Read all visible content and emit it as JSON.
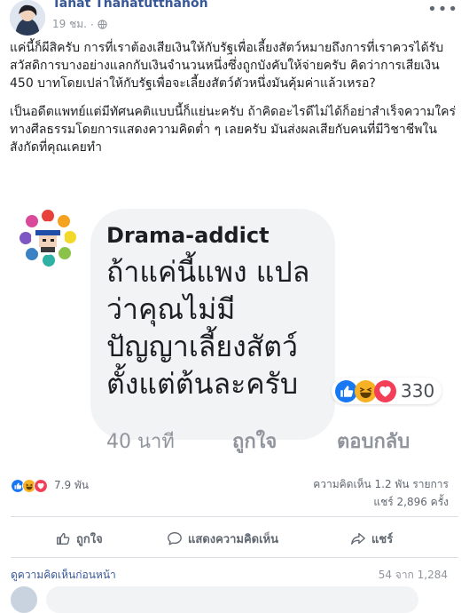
{
  "post": {
    "author": "Tanat Thanatutthanon",
    "time": "19 ชม.",
    "separator": "·",
    "paragraphs": [
      "แค่นี้ก็ผีสิครับ การที่เราต้องเสียเงินให้กับรัฐเพื่อเลี้ยงสัตว์หมายถึงการที่เราควรได้รับสวัสดิการบางอย่างแลกกับเงินจำนวนหนึ่งซึ่งถูกบังคับให้จ่ายครับ คิดว่าการเสียเงิน 450 บาทโดยเปล่าให้กับรัฐเพื่อจะเลี้ยงสัตว์ตัวหนึ่งมันคุ้มค่าแล้วเหรอ?",
      "เป็นอดีตแพทย์แต่มีทัศนคติแบบนี้ก็แย่นะครับ ถ้าคิดอะไรดีไม่ได้ก็อย่าสำเร็จความใคร่ทางศีลธรรมโดยการแสดงความคิดต่ำ ๆ เลยครับ มันส่งผลเสียกับคนที่มีวิชาชีพในสังกัดที่คุณเคยทำ"
    ],
    "more_label": "•••"
  },
  "embedded": {
    "commenter": "Drama-addict",
    "comment_lines": [
      "ถ้าแค่นี้แพง แปล",
      "ว่าคุณไม่มี",
      "ปัญญาเลี้ยงสัตว์",
      "ตั้งแต่ต้นละครับ"
    ],
    "reaction_count": "330",
    "time": "40 นาที",
    "like_label": "ถูกใจ",
    "reply_label": "ตอบกลับ"
  },
  "summary": {
    "reaction_count": "7.9 พัน",
    "comments": "ความคิดเห็น 1.2 พัน รายการ",
    "shares": "แชร์ 2,896 ครั้ง"
  },
  "actions": {
    "like": "ถูกใจ",
    "comment": "แสดงความคิดเห็น",
    "share": "แชร์"
  },
  "comments": {
    "view_previous": "ดูความคิดเห็นก่อนหน้า",
    "pagination": "54 จาก 1,284"
  },
  "colors": {
    "link": "#385898",
    "like_blue": "#1877f2",
    "haha_yellow": "#f7b125",
    "love_red": "#f33e58",
    "muted": "#90949c"
  },
  "icons": [
    "globe-icon",
    "more-icon",
    "like-reaction-icon",
    "haha-reaction-icon",
    "love-reaction-icon",
    "thumbs-up-icon",
    "comment-icon",
    "share-icon"
  ]
}
